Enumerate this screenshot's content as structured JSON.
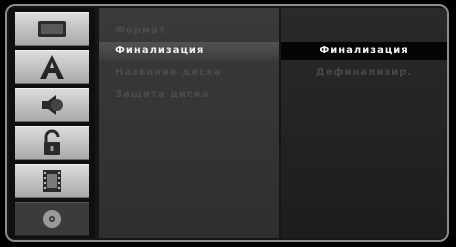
{
  "sidebar": {
    "icons": [
      {
        "name": "monitor-icon"
      },
      {
        "name": "letter-a-icon"
      },
      {
        "name": "speaker-icon"
      },
      {
        "name": "lock-icon"
      },
      {
        "name": "film-icon"
      },
      {
        "name": "disc-icon",
        "active": true
      }
    ]
  },
  "menu": {
    "items": [
      {
        "label": "Формат"
      },
      {
        "label": "Финализация",
        "active": true
      },
      {
        "label": "Название диска"
      },
      {
        "label": "Защита диска"
      }
    ]
  },
  "submenu": {
    "items": [
      {
        "label": "Финализация",
        "active": true
      },
      {
        "label": "Дефинализир."
      }
    ]
  }
}
